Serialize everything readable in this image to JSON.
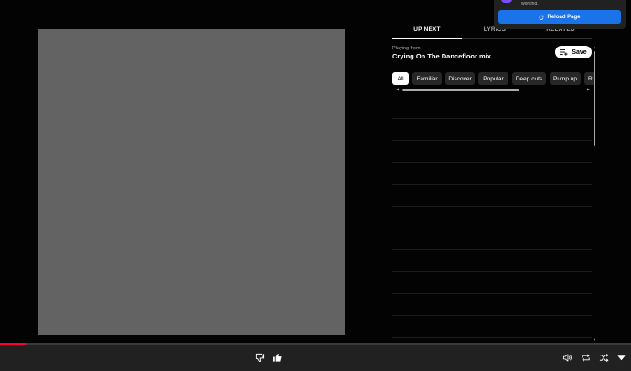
{
  "tabs": [
    {
      "label": "UP NEXT",
      "active": true
    },
    {
      "label": "LYRICS",
      "active": false
    },
    {
      "label": "RELATED",
      "active": false
    }
  ],
  "queue": {
    "playing_from_label": "Playing from",
    "playlist_title": "Crying On The Dancefloor mix",
    "save_label": "Save"
  },
  "chips": [
    {
      "label": "All",
      "selected": true
    },
    {
      "label": "Familiar",
      "selected": false
    },
    {
      "label": "Discover",
      "selected": false
    },
    {
      "label": "Popular",
      "selected": false
    },
    {
      "label": "Deep cuts",
      "selected": false
    },
    {
      "label": "Pump up",
      "selected": false
    },
    {
      "label": "R",
      "selected": false
    }
  ],
  "toast": {
    "message": "working.",
    "reload_label": "Reload Page"
  },
  "player": {
    "progress_fraction": 0.04,
    "progress_color": "#ff0033",
    "controls": [
      "thumbs-down-icon",
      "thumbs-up-icon",
      "volume-icon",
      "repeat-icon",
      "shuffle-icon",
      "expand-icon"
    ]
  },
  "colors": {
    "background": "#030303",
    "album_art_placeholder": "#636363",
    "accent_blue": "#1a73e8",
    "chip_bg": "#272727"
  }
}
